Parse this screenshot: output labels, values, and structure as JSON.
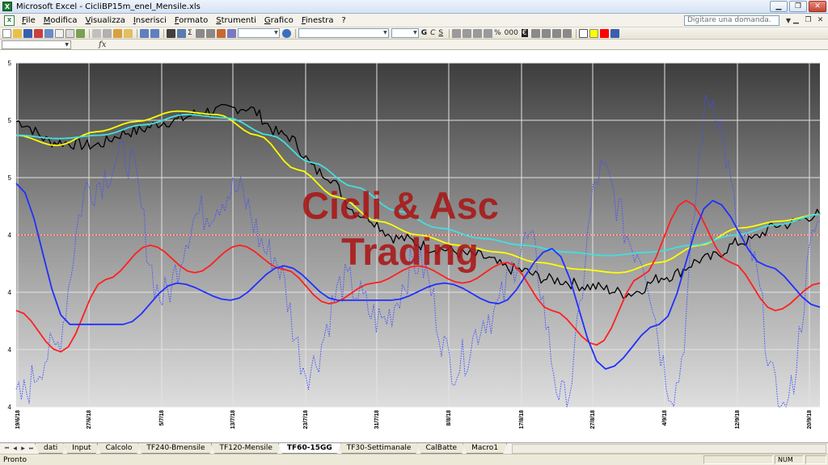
{
  "window": {
    "title": "Microsoft Excel - CicliBP15m_enel_Mensile.xls",
    "icon": "excel-icon",
    "controls": [
      "minimize",
      "maximize",
      "close"
    ]
  },
  "menu": {
    "items": [
      "File",
      "Modifica",
      "Visualizza",
      "Inserisci",
      "Formato",
      "Strumenti",
      "Grafico",
      "Finestra",
      "?"
    ],
    "help_placeholder": "Digitare una domanda.",
    "doc_controls": [
      "minimize",
      "restore",
      "close"
    ]
  },
  "toolbar": {
    "sum_symbol": "Σ",
    "bold": "G",
    "italic": "C",
    "underline": "S",
    "percent": "%",
    "thousands": "000",
    "euro": "€"
  },
  "formula": {
    "fx_label": "fx"
  },
  "watermark": {
    "line1": "Cicli & Asc",
    "line2": "Trading"
  },
  "chart_data": {
    "type": "line",
    "x_dates": [
      "19/6/18",
      "27/6/18",
      "5/7/18",
      "13/7/18",
      "23/7/18",
      "31/7/18",
      "8/8/18",
      "17/8/18",
      "27/8/18",
      "4/9/18",
      "12/9/18",
      "20/9/18"
    ],
    "y_tick_labels": [
      "5",
      "5",
      "5",
      "4",
      "4",
      "4",
      "4"
    ],
    "reference_line": {
      "color": "#ff4040",
      "style": "dotted"
    },
    "series": [
      {
        "color": "#000000",
        "values": [
          5.03,
          4.97,
          4.96,
          5.0,
          5.03,
          5.06,
          5.07,
          4.99,
          4.88,
          4.76,
          4.69,
          4.66,
          4.64,
          4.6,
          4.57,
          4.55,
          4.53,
          4.58,
          4.63,
          4.68,
          4.73,
          4.76
        ]
      },
      {
        "color": "#ffff00",
        "values": [
          4.99,
          4.96,
          5.0,
          5.03,
          5.06,
          5.05,
          4.99,
          4.89,
          4.81,
          4.74,
          4.7,
          4.67,
          4.65,
          4.62,
          4.6,
          4.59,
          4.62,
          4.67,
          4.72,
          4.74,
          4.76
        ]
      },
      {
        "color": "#40e0e0",
        "values": [
          4.99,
          4.98,
          4.99,
          5.02,
          5.05,
          5.04,
          4.99,
          4.91,
          4.84,
          4.77,
          4.72,
          4.69,
          4.67,
          4.65,
          4.64,
          4.65,
          4.67,
          4.7,
          4.73,
          4.76
        ]
      },
      {
        "color": "#ff2020",
        "values": [
          4.48,
          4.36,
          4.57,
          4.67,
          4.59,
          4.67,
          4.6,
          4.5,
          4.56,
          4.61,
          4.56,
          4.62,
          4.48,
          4.38,
          4.58,
          4.8,
          4.62,
          4.48,
          4.56
        ]
      },
      {
        "color": "#2030ff",
        "values": [
          4.85,
          4.44,
          4.44,
          4.56,
          4.51,
          4.61,
          4.51,
          4.51,
          4.56,
          4.5,
          4.66,
          4.31,
          4.44,
          4.8,
          4.61,
          4.49
        ]
      },
      {
        "color": "#4050ff",
        "style": "dotted",
        "values": [
          4.22,
          4.36,
          4.84,
          4.93,
          4.52,
          4.76,
          4.83,
          4.64,
          4.31,
          4.56,
          4.45,
          4.62,
          4.32,
          4.47,
          4.68,
          4.22,
          4.88,
          4.66,
          4.25,
          5.1,
          4.66,
          4.18,
          4.74
        ]
      }
    ]
  },
  "sheets": {
    "tabs": [
      "dati",
      "Input",
      "Calcolo",
      "TF240-Bmensile",
      "TF120-Mensile",
      "TF60-15GG",
      "TF30-Settimanale",
      "CalBatte",
      "Macro1"
    ],
    "active": "TF60-15GG"
  },
  "status": {
    "left": "Pronto",
    "num": "NUM"
  }
}
